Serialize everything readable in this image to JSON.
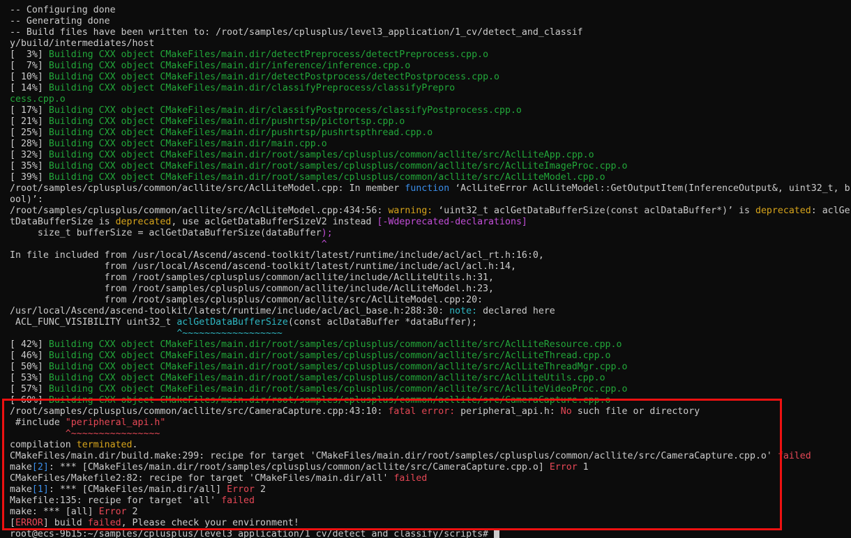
{
  "colors": {
    "background": "#0c0c0c",
    "default": "#cccccc",
    "green": "#22a83a",
    "blue": "#3b8eea",
    "yellow": "#d8a51b",
    "magenta": "#c24ed8",
    "cyan": "#2fb8c4",
    "red": "#e74856",
    "annotation": "#ee1111",
    "cursor": "#cccccc"
  },
  "terminal": {
    "lines": [
      {
        "segments": [
          {
            "text": "-- Configuring done",
            "color": "default"
          }
        ]
      },
      {
        "segments": [
          {
            "text": "-- Generating done",
            "color": "default"
          }
        ]
      },
      {
        "segments": [
          {
            "text": "-- Build files have been written to: /root/samples/cplusplus/level3_application/1_cv/detect_and_classif",
            "color": "default"
          }
        ]
      },
      {
        "segments": [
          {
            "text": "y/build/intermediates/host",
            "color": "default"
          }
        ]
      },
      {
        "segments": [
          {
            "text": "[  3%] ",
            "color": "default"
          },
          {
            "text": "Building CXX object CMakeFiles/main.dir/detectPreprocess/detectPreprocess.cpp.o",
            "color": "green"
          }
        ]
      },
      {
        "segments": [
          {
            "text": "[  7%] ",
            "color": "default"
          },
          {
            "text": "Building CXX object CMakeFiles/main.dir/inference/inference.cpp.o",
            "color": "green"
          }
        ]
      },
      {
        "segments": [
          {
            "text": "[ 10%] ",
            "color": "default"
          },
          {
            "text": "Building CXX object CMakeFiles/main.dir/detectPostprocess/detectPostprocess.cpp.o",
            "color": "green"
          }
        ]
      },
      {
        "segments": [
          {
            "text": "[ 14%] ",
            "color": "default"
          },
          {
            "text": "Building CXX object CMakeFiles/main.dir/classifyPreprocess/classifyPrepro",
            "color": "green"
          }
        ]
      },
      {
        "segments": [
          {
            "text": "cess.cpp.o",
            "color": "green"
          }
        ]
      },
      {
        "segments": [
          {
            "text": "[ 17%] ",
            "color": "default"
          },
          {
            "text": "Building CXX object CMakeFiles/main.dir/classifyPostprocess/classifyPostprocess.cpp.o",
            "color": "green"
          }
        ]
      },
      {
        "segments": [
          {
            "text": "[ 21%] ",
            "color": "default"
          },
          {
            "text": "Building CXX object CMakeFiles/main.dir/pushrtsp/pictortsp.cpp.o",
            "color": "green"
          }
        ]
      },
      {
        "segments": [
          {
            "text": "[ 25%] ",
            "color": "default"
          },
          {
            "text": "Building CXX object CMakeFiles/main.dir/pushrtsp/pushrtspthread.cpp.o",
            "color": "green"
          }
        ]
      },
      {
        "segments": [
          {
            "text": "[ 28%] ",
            "color": "default"
          },
          {
            "text": "Building CXX object CMakeFiles/main.dir/main.cpp.o",
            "color": "green"
          }
        ]
      },
      {
        "segments": [
          {
            "text": "[ 32%] ",
            "color": "default"
          },
          {
            "text": "Building CXX object CMakeFiles/main.dir/root/samples/cplusplus/common/acllite/src/AclLiteApp.cpp.o",
            "color": "green"
          }
        ]
      },
      {
        "segments": [
          {
            "text": "[ 35%] ",
            "color": "default"
          },
          {
            "text": "Building CXX object CMakeFiles/main.dir/root/samples/cplusplus/common/acllite/src/AclLiteImageProc.cpp.o",
            "color": "green"
          }
        ]
      },
      {
        "segments": [
          {
            "text": "[ 39%] ",
            "color": "default"
          },
          {
            "text": "Building CXX object CMakeFiles/main.dir/root/samples/cplusplus/common/acllite/src/AclLiteModel.cpp.o",
            "color": "green"
          }
        ]
      },
      {
        "segments": [
          {
            "text": "/root/samples/cplusplus/common/acllite/src/AclLiteModel.cpp: In member ",
            "color": "default"
          },
          {
            "text": "function",
            "color": "blue"
          },
          {
            "text": " ‘AclLiteError AclLiteModel::GetOutputItem(InferenceOutput&, uint32_t, b",
            "color": "default"
          }
        ]
      },
      {
        "segments": [
          {
            "text": "ool)’:",
            "color": "default"
          }
        ]
      },
      {
        "segments": [
          {
            "text": "/root/samples/cplusplus/common/acllite/src/AclLiteModel.cpp:434:56: ",
            "color": "default"
          },
          {
            "text": "warning:",
            "color": "yellow"
          },
          {
            "text": " ‘uint32_t aclGetDataBufferSize(const aclDataBuffer*)’ is ",
            "color": "default"
          },
          {
            "text": "deprecated",
            "color": "yellow"
          },
          {
            "text": ": aclGe",
            "color": "default"
          }
        ]
      },
      {
        "segments": [
          {
            "text": "tDataBufferSize is ",
            "color": "default"
          },
          {
            "text": "deprecated",
            "color": "yellow"
          },
          {
            "text": ", use aclGetDataBufferSizeV2 instead ",
            "color": "default"
          },
          {
            "text": "[-Wdeprecated-declarations]",
            "color": "magenta"
          }
        ]
      },
      {
        "segments": [
          {
            "text": "     size_t bufferSize = aclGetDataBufferSize(dataBuffer",
            "color": "default"
          },
          {
            "text": ");",
            "color": "magenta"
          }
        ]
      },
      {
        "segments": [
          {
            "text": "                                                        ",
            "color": "default"
          },
          {
            "text": "^",
            "color": "magenta"
          }
        ]
      },
      {
        "segments": [
          {
            "text": "In file included from /usr/local/Ascend/ascend-toolkit/latest/runtime/include/acl/acl_rt.h:16:0,",
            "color": "default"
          }
        ]
      },
      {
        "segments": [
          {
            "text": "                 from /usr/local/Ascend/ascend-toolkit/latest/runtime/include/acl/acl.h:14,",
            "color": "default"
          }
        ]
      },
      {
        "segments": [
          {
            "text": "                 from /root/samples/cplusplus/common/acllite/include/AclLiteUtils.h:31,",
            "color": "default"
          }
        ]
      },
      {
        "segments": [
          {
            "text": "                 from /root/samples/cplusplus/common/acllite/include/AclLiteModel.h:23,",
            "color": "default"
          }
        ]
      },
      {
        "segments": [
          {
            "text": "                 from /root/samples/cplusplus/common/acllite/src/AclLiteModel.cpp:20:",
            "color": "default"
          }
        ]
      },
      {
        "segments": [
          {
            "text": "/usr/local/Ascend/ascend-toolkit/latest/runtime/include/acl/acl_base.h:288:30: ",
            "color": "default"
          },
          {
            "text": "note:",
            "color": "cyan"
          },
          {
            "text": " declared here",
            "color": "default"
          }
        ]
      },
      {
        "segments": [
          {
            "text": " ACL_FUNC_VISIBILITY uint32_t ",
            "color": "default"
          },
          {
            "text": "aclGetDataBufferSize",
            "color": "cyan"
          },
          {
            "text": "(const aclDataBuffer *dataBuffer);",
            "color": "default"
          }
        ]
      },
      {
        "segments": [
          {
            "text": "                              ",
            "color": "default"
          },
          {
            "text": "^~~~~~~~~~~~~~~~~~~",
            "color": "cyan"
          }
        ]
      },
      {
        "segments": [
          {
            "text": "[ 42%] ",
            "color": "default"
          },
          {
            "text": "Building CXX object CMakeFiles/main.dir/root/samples/cplusplus/common/acllite/src/AclLiteResource.cpp.o",
            "color": "green"
          }
        ]
      },
      {
        "segments": [
          {
            "text": "[ 46%] ",
            "color": "default"
          },
          {
            "text": "Building CXX object CMakeFiles/main.dir/root/samples/cplusplus/common/acllite/src/AclLiteThread.cpp.o",
            "color": "green"
          }
        ]
      },
      {
        "segments": [
          {
            "text": "[ 50%] ",
            "color": "default"
          },
          {
            "text": "Building CXX object CMakeFiles/main.dir/root/samples/cplusplus/common/acllite/src/AclLiteThreadMgr.cpp.o",
            "color": "green"
          }
        ]
      },
      {
        "segments": [
          {
            "text": "[ 53%] ",
            "color": "default"
          },
          {
            "text": "Building CXX object CMakeFiles/main.dir/root/samples/cplusplus/common/acllite/src/AclLiteUtils.cpp.o",
            "color": "green"
          }
        ]
      },
      {
        "segments": [
          {
            "text": "[ 57%] ",
            "color": "default"
          },
          {
            "text": "Building CXX object CMakeFiles/main.dir/root/samples/cplusplus/common/acllite/src/AclLiteVideoProc.cpp.o",
            "color": "green"
          }
        ]
      },
      {
        "segments": [
          {
            "text": "[ 60%] ",
            "color": "default"
          },
          {
            "text": "Building CXX object CMakeFiles/main.dir/root/samples/cplusplus/common/acllite/src/CameraCapture.cpp.o",
            "color": "green"
          }
        ]
      },
      {
        "segments": [
          {
            "text": "/root/samples/cplusplus/common/acllite/src/CameraCapture.cpp:43:10: ",
            "color": "default"
          },
          {
            "text": "fatal error:",
            "color": "red"
          },
          {
            "text": " peripheral_api.h: ",
            "color": "default"
          },
          {
            "text": "No",
            "color": "red"
          },
          {
            "text": " such file or directory",
            "color": "default"
          }
        ]
      },
      {
        "segments": [
          {
            "text": " #include ",
            "color": "default"
          },
          {
            "text": "\"peripheral_api.h\"",
            "color": "red"
          }
        ]
      },
      {
        "segments": [
          {
            "text": "          ",
            "color": "default"
          },
          {
            "text": "^~~~~~~~~~~~~~~~~",
            "color": "red"
          }
        ]
      },
      {
        "segments": [
          {
            "text": "compilation ",
            "color": "default"
          },
          {
            "text": "terminated",
            "color": "yellow"
          },
          {
            "text": ".",
            "color": "default"
          }
        ]
      },
      {
        "segments": [
          {
            "text": "CMakeFiles/main.dir/build.make:299: recipe for target 'CMakeFiles/main.dir/root/samples/cplusplus/common/acllite/src/CameraCapture.cpp.o' ",
            "color": "default"
          },
          {
            "text": "failed",
            "color": "red"
          }
        ]
      },
      {
        "segments": [
          {
            "text": "make",
            "color": "default"
          },
          {
            "text": "[2]",
            "color": "blue"
          },
          {
            "text": ": *** [CMakeFiles/main.dir/root/samples/cplusplus/common/acllite/src/CameraCapture.cpp.o] ",
            "color": "default"
          },
          {
            "text": "Error",
            "color": "red"
          },
          {
            "text": " 1",
            "color": "default"
          }
        ]
      },
      {
        "segments": [
          {
            "text": "CMakeFiles/Makefile2:82: recipe for target 'CMakeFiles/main.dir/all' ",
            "color": "default"
          },
          {
            "text": "failed",
            "color": "red"
          }
        ]
      },
      {
        "segments": [
          {
            "text": "make",
            "color": "default"
          },
          {
            "text": "[1]",
            "color": "blue"
          },
          {
            "text": ": *** [CMakeFiles/main.dir/all] ",
            "color": "default"
          },
          {
            "text": "Error",
            "color": "red"
          },
          {
            "text": " 2",
            "color": "default"
          }
        ]
      },
      {
        "segments": [
          {
            "text": "Makefile:135: recipe for target 'all' ",
            "color": "default"
          },
          {
            "text": "failed",
            "color": "red"
          }
        ]
      },
      {
        "segments": [
          {
            "text": "make: *** [all] ",
            "color": "default"
          },
          {
            "text": "Error",
            "color": "red"
          },
          {
            "text": " 2",
            "color": "default"
          }
        ]
      },
      {
        "segments": [
          {
            "text": "[",
            "color": "default"
          },
          {
            "text": "ERROR",
            "color": "red"
          },
          {
            "text": "] build ",
            "color": "default"
          },
          {
            "text": "failed",
            "color": "red"
          },
          {
            "text": ", Please check your environment!",
            "color": "default"
          }
        ]
      }
    ],
    "prompt": "root@ecs-9b15:~/samples/cplusplus/level3_application/1_cv/detect_and_classify/scripts# "
  }
}
